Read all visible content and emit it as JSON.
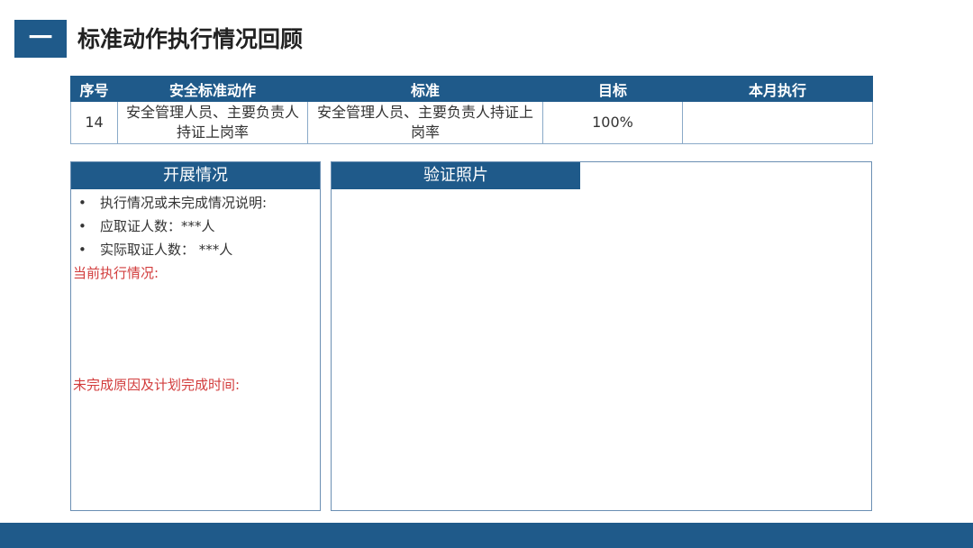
{
  "header": {
    "badge": "一",
    "title": "标准动作执行情况回顾"
  },
  "table": {
    "columns": [
      "序号",
      "安全标准动作",
      "标准",
      "目标",
      "本月执行"
    ],
    "rows": [
      [
        "14",
        "安全管理人员、主要负责人持证上岗率",
        "安全管理人员、主要负责人持证上岗率",
        "100%",
        ""
      ]
    ]
  },
  "progress_panel": {
    "title": "开展情况",
    "bullets": [
      "执行情况或未完成情况说明:",
      "应取证人数：***人",
      "实际取证人数：  ***人"
    ],
    "current_status_label": "当前执行情况:",
    "reason_label": "未完成原因及计划完成时间:"
  },
  "photo_panel": {
    "title": "验证照片"
  }
}
